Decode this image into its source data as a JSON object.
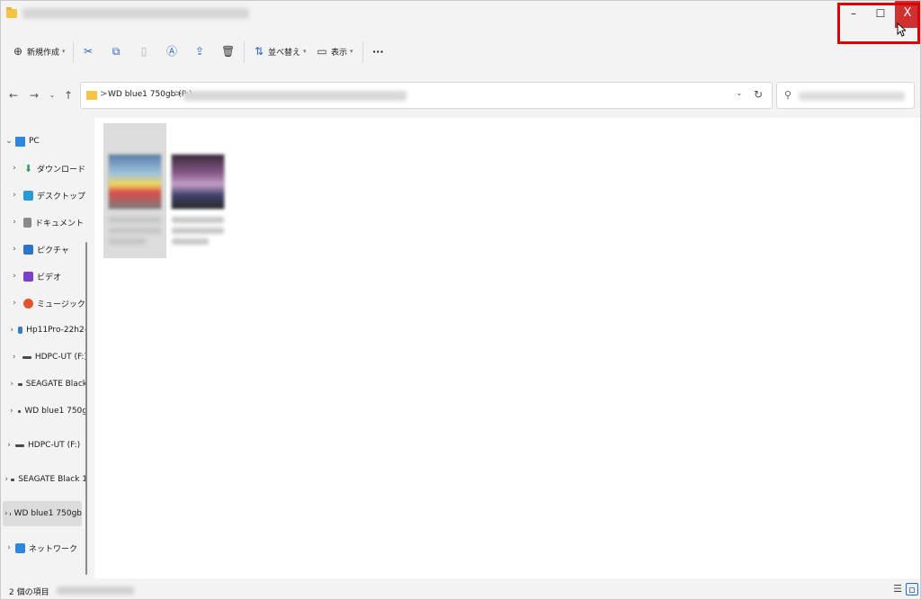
{
  "window": {
    "title": "",
    "controls": {
      "minimize": "–",
      "maximize": "☐",
      "close": "X"
    }
  },
  "toolbar": {
    "new_label": "新規作成",
    "sort_label": "並べ替え",
    "view_label": "表示",
    "more_label": "···"
  },
  "address": {
    "drive": "WD blue1 750gb (P:)",
    "separator": ">"
  },
  "search": {
    "placeholder": ""
  },
  "sidebar": {
    "pc": "PC",
    "items": [
      {
        "label": "ダウンロード",
        "icon": "download-icon"
      },
      {
        "label": "デスクトップ",
        "icon": "desktop-icon"
      },
      {
        "label": "ドキュメント",
        "icon": "document-icon"
      },
      {
        "label": "ピクチャ",
        "icon": "pictures-icon"
      },
      {
        "label": "ビデオ",
        "icon": "video-icon"
      },
      {
        "label": "ミュージック",
        "icon": "music-icon"
      },
      {
        "label": "Hp11Pro-22h2-",
        "icon": "computer-icon"
      },
      {
        "label": "HDPC-UT (F:)",
        "icon": "drive-icon"
      },
      {
        "label": "SEAGATE Black",
        "icon": "drive-icon"
      },
      {
        "label": "WD blue1 750g",
        "icon": "drive-icon"
      }
    ],
    "drives": [
      {
        "label": "HDPC-UT (F:)"
      },
      {
        "label": "SEAGATE Black 1"
      },
      {
        "label": "WD blue1 750gb"
      }
    ],
    "network": "ネットワーク"
  },
  "content": {
    "files": [
      {
        "name": ""
      },
      {
        "name": ""
      }
    ]
  },
  "status": {
    "count": "2 個の項目"
  },
  "colors": {
    "close_button": "#cf3030",
    "highlight_frame": "#e00000",
    "accent": "#2a68c7"
  }
}
